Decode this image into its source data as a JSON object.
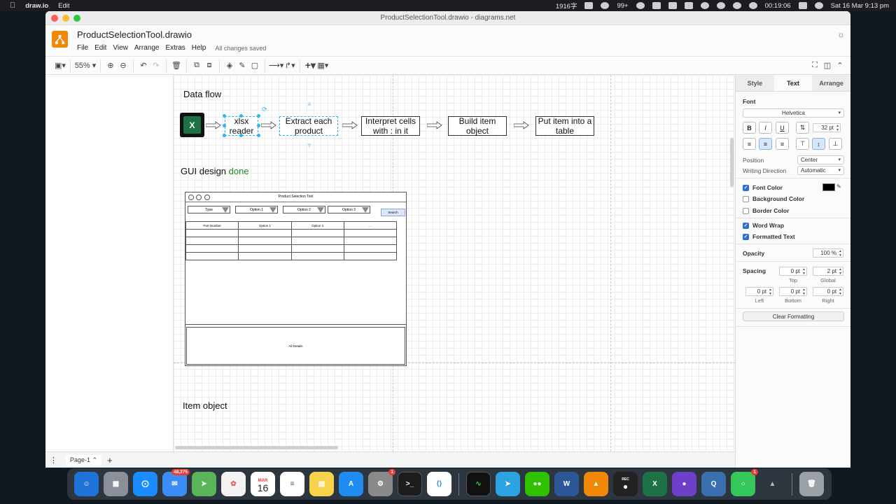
{
  "menubar": {
    "app_name": "draw.io",
    "menu_edit": "Edit",
    "status_items": [
      "1916字",
      "99+",
      "00:19:06"
    ],
    "clock": "Sat 16 Mar  9:13 pm"
  },
  "window": {
    "title": "ProductSelectionTool.drawio - diagrams.net"
  },
  "app": {
    "doc_title": "ProductSelectionTool.drawio",
    "menus": [
      "File",
      "Edit",
      "View",
      "Arrange",
      "Extras",
      "Help"
    ],
    "saved_status": "All changes saved"
  },
  "toolbar": {
    "zoom": "55%"
  },
  "canvas": {
    "data_flow_label": "Data flow",
    "gui_label": "GUI design",
    "gui_done": "done",
    "item_object_label": "Item object",
    "flow_boxes": [
      "xlsx reader",
      "Extract each product",
      "Interpret cells with : in it",
      "Build item object",
      "Put item into a table"
    ],
    "excel_icon_letter": "X",
    "mockup": {
      "title": "Product Selection Tool",
      "dropdowns": [
        "Type",
        "Option 1",
        "Option 2",
        "Option 3"
      ],
      "search_label": "Search",
      "columns": [
        "Part Number",
        "Option 1",
        "Option 2",
        "..."
      ],
      "details_label": "All Details"
    }
  },
  "panel": {
    "tabs": [
      "Style",
      "Text",
      "Arrange"
    ],
    "active_tab": "Text",
    "font_heading": "Font",
    "font_family": "Helvetica",
    "font_size": "32 pt",
    "position_label": "Position",
    "position_value": "Center",
    "writing_direction_label": "Writing Direction",
    "writing_direction_value": "Automatic",
    "font_color_label": "Font Color",
    "font_color_checked": true,
    "font_color": "#000000",
    "background_color_label": "Background Color",
    "background_color_checked": false,
    "border_color_label": "Border Color",
    "border_color_checked": false,
    "word_wrap_label": "Word Wrap",
    "word_wrap_checked": true,
    "formatted_text_label": "Formatted Text",
    "formatted_text_checked": true,
    "opacity_label": "Opacity",
    "opacity_value": "100 %",
    "spacing_label": "Spacing",
    "spacing_top": "0 pt",
    "spacing_global": "2 pt",
    "spacing_left": "0 pt",
    "spacing_bottom": "0 pt",
    "spacing_right": "0 pt",
    "top_label": "Top",
    "global_label": "Global",
    "left_label": "Left",
    "bottom_label": "Bottom",
    "right_label": "Right",
    "clear_formatting": "Clear Formatting"
  },
  "pagebar": {
    "page_name": "Page-1"
  },
  "dock": {
    "mail_badge": "48,275",
    "calendar_month": "MAR",
    "calendar_day": "16",
    "settings_badge": "1",
    "messages_badge": "1",
    "rec_label": "REC"
  },
  "colors": {
    "accent": "#29b6f2",
    "drawio_orange": "#f08705",
    "done_green": "#1f8a1f"
  }
}
